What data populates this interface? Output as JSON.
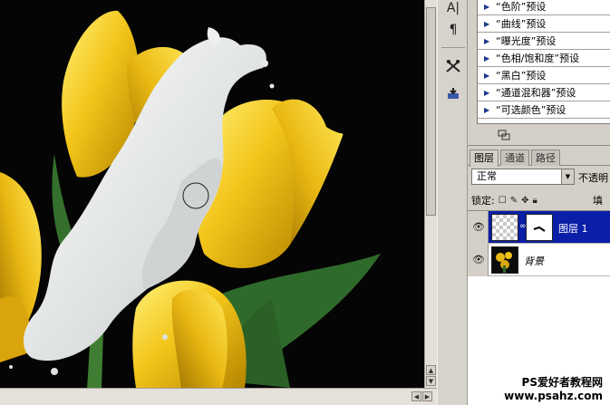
{
  "presets_panel": {
    "items": [
      "“色阶”预设",
      "“曲线”预设",
      "“曝光度”预设",
      "“色相/饱和度”预设",
      "“黑白”预设",
      "“通道混和器”预设",
      "“可选颜色”预设"
    ],
    "expand_icon": "triangle-right-icon",
    "footer_icon": "panel-return-icon"
  },
  "layers_panel": {
    "tabs": [
      "图层",
      "通道",
      "路径"
    ],
    "active_tab": "图层",
    "blend_mode": "正常",
    "opacity_label": "不透明",
    "lock_label": "锁定:",
    "fill_label": "填",
    "layers": [
      {
        "name": "图层 1",
        "selected": true,
        "visible": true,
        "has_mask": true
      },
      {
        "name": "背景",
        "selected": false,
        "visible": true,
        "has_mask": false
      }
    ],
    "selection_color": "#0a1ea8"
  },
  "toolstrip": {
    "icons": [
      "character-icon",
      "paragraph-icon",
      "tool-presets-icon",
      "clone-source-icon"
    ],
    "labels": [
      "A|",
      "¶"
    ]
  },
  "canvas": {
    "description_colors": {
      "background": "#050505",
      "petal": "#f2c418",
      "leaf": "#2f6a2a",
      "milk": "#e4e6e6"
    }
  },
  "watermark": {
    "line1": "PS爱好者教程网",
    "line2": "www.psahz.com"
  }
}
